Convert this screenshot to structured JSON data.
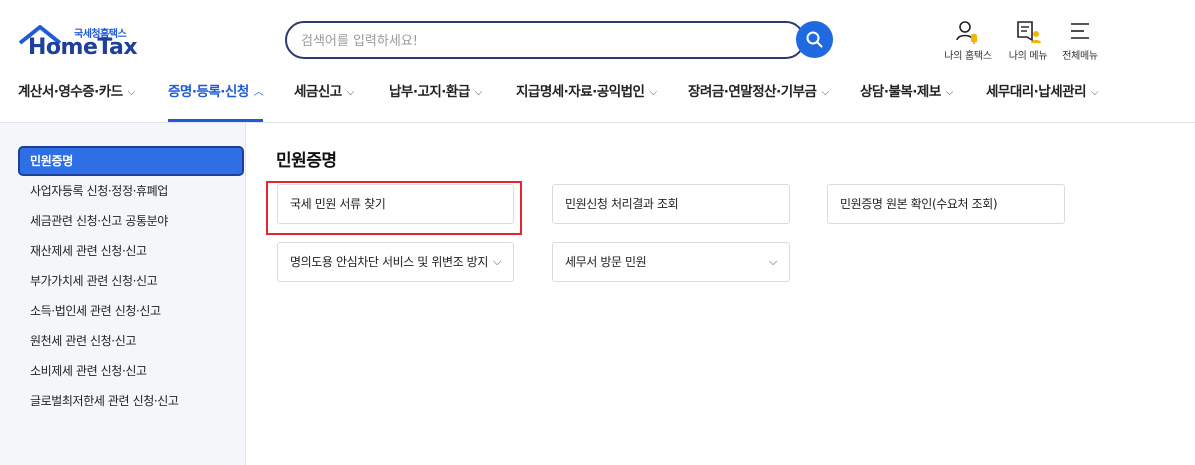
{
  "logo": {
    "sub": "국세청홈택스",
    "main": "HomeTax"
  },
  "search": {
    "placeholder": "검색어를 입력하세요!"
  },
  "util": [
    {
      "label": "나의 홈택스",
      "icon": "my-hometax-icon"
    },
    {
      "label": "나의 메뉴",
      "icon": "my-menu-icon"
    },
    {
      "label": "전체메뉴",
      "icon": "hamburger-menu-icon"
    }
  ],
  "gnb": [
    {
      "label": "계산서·영수증·카드",
      "chev": "⌵"
    },
    {
      "label": "증명·등록·신청",
      "chev": "︿"
    },
    {
      "label": "세금신고",
      "chev": "⌵"
    },
    {
      "label": "납부·고지·환급",
      "chev": "⌵"
    },
    {
      "label": "지급명세·자료·공익법인",
      "chev": "⌵"
    },
    {
      "label": "장려금·연말정산·기부금",
      "chev": "⌵"
    },
    {
      "label": "상담·불복·제보",
      "chev": "⌵"
    },
    {
      "label": "세무대리·납세관리",
      "chev": "⌵"
    }
  ],
  "sidebar": {
    "active": "민원증명",
    "items": [
      "사업자등록 신청·정정·휴폐업",
      "세금관련 신청·신고 공통분야",
      "재산제세 관련 신청·신고",
      "부가가치세 관련 신청·신고",
      "소득·법인세 관련 신청·신고",
      "원천세 관련 신청·신고",
      "소비제세 관련 신청·신고",
      "글로벌최저한세 관련 신청·신고"
    ]
  },
  "main": {
    "title": "민원증명",
    "cards": [
      {
        "label": "국세 민원 서류 찾기",
        "chev": ""
      },
      {
        "label": "민원신청 처리결과 조회",
        "chev": ""
      },
      {
        "label": "민원증명 원본 확인(수요처 조회)",
        "chev": ""
      },
      {
        "label": "명의도용 안심차단 서비스 및 위변조 방지",
        "chev": "⌵"
      },
      {
        "label": "세무서 방문 민원",
        "chev": "⌵"
      }
    ]
  },
  "colors": {
    "accent": "#1f5bd6",
    "highlight": "#e3262b",
    "searchButton": "#1f6ae0"
  }
}
